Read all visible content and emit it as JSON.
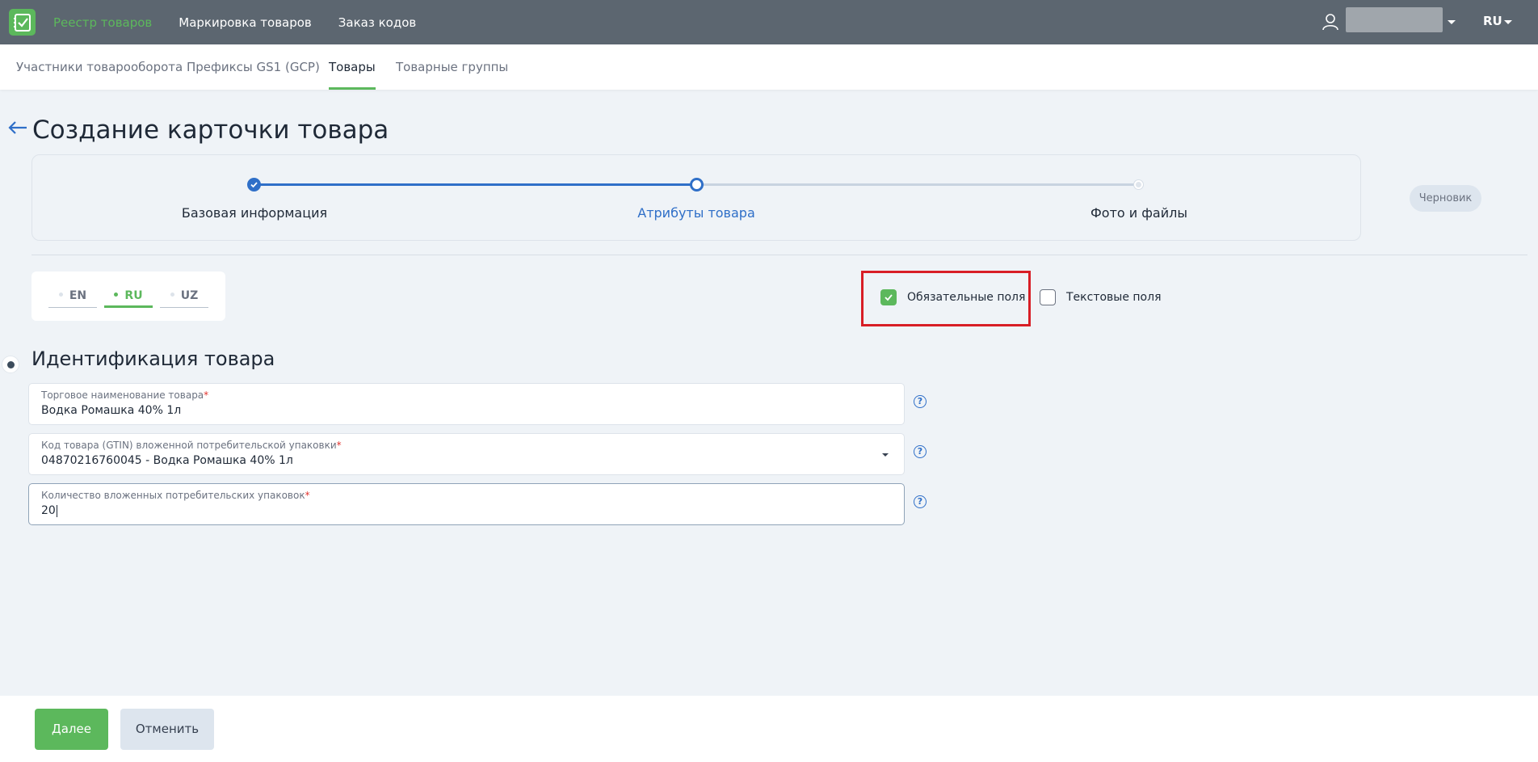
{
  "topbar": {
    "nav": [
      "Реестр товаров",
      "Маркировка товаров",
      "Заказ кодов"
    ],
    "lang": "RU"
  },
  "subnav": {
    "tabs": [
      "Участники товарооборота",
      "Префиксы GS1 (GCP)",
      "Товары",
      "Товарные группы"
    ],
    "active": "Товары"
  },
  "page": {
    "title": "Создание карточки товара"
  },
  "stepper": {
    "steps": [
      "Базовая информация",
      "Атрибуты товара",
      "Фото и файлы"
    ]
  },
  "status": "Черновик",
  "lang_tabs": [
    "EN",
    "RU",
    "UZ"
  ],
  "filters": {
    "required": "Обязательные поля",
    "text": "Текстовые поля"
  },
  "section": {
    "title": "Идентификация товара",
    "fields": [
      {
        "label": "Торговое наименование товара",
        "value": "Водка Ромашка 40% 1л"
      },
      {
        "label": "Код товара (GTIN) вложенной потребительской упаковки",
        "value": "04870216760045 - Водка Ромашка 40% 1л"
      },
      {
        "label": "Количество вложенных потребительских упаковок",
        "value": "20"
      }
    ]
  },
  "footer": {
    "next": "Далее",
    "cancel": "Отменить"
  },
  "colors": {
    "accent_green": "#5cb85c",
    "accent_blue": "#2f6fc8",
    "topbar": "#5c6670",
    "highlight_red": "#d81e26"
  }
}
